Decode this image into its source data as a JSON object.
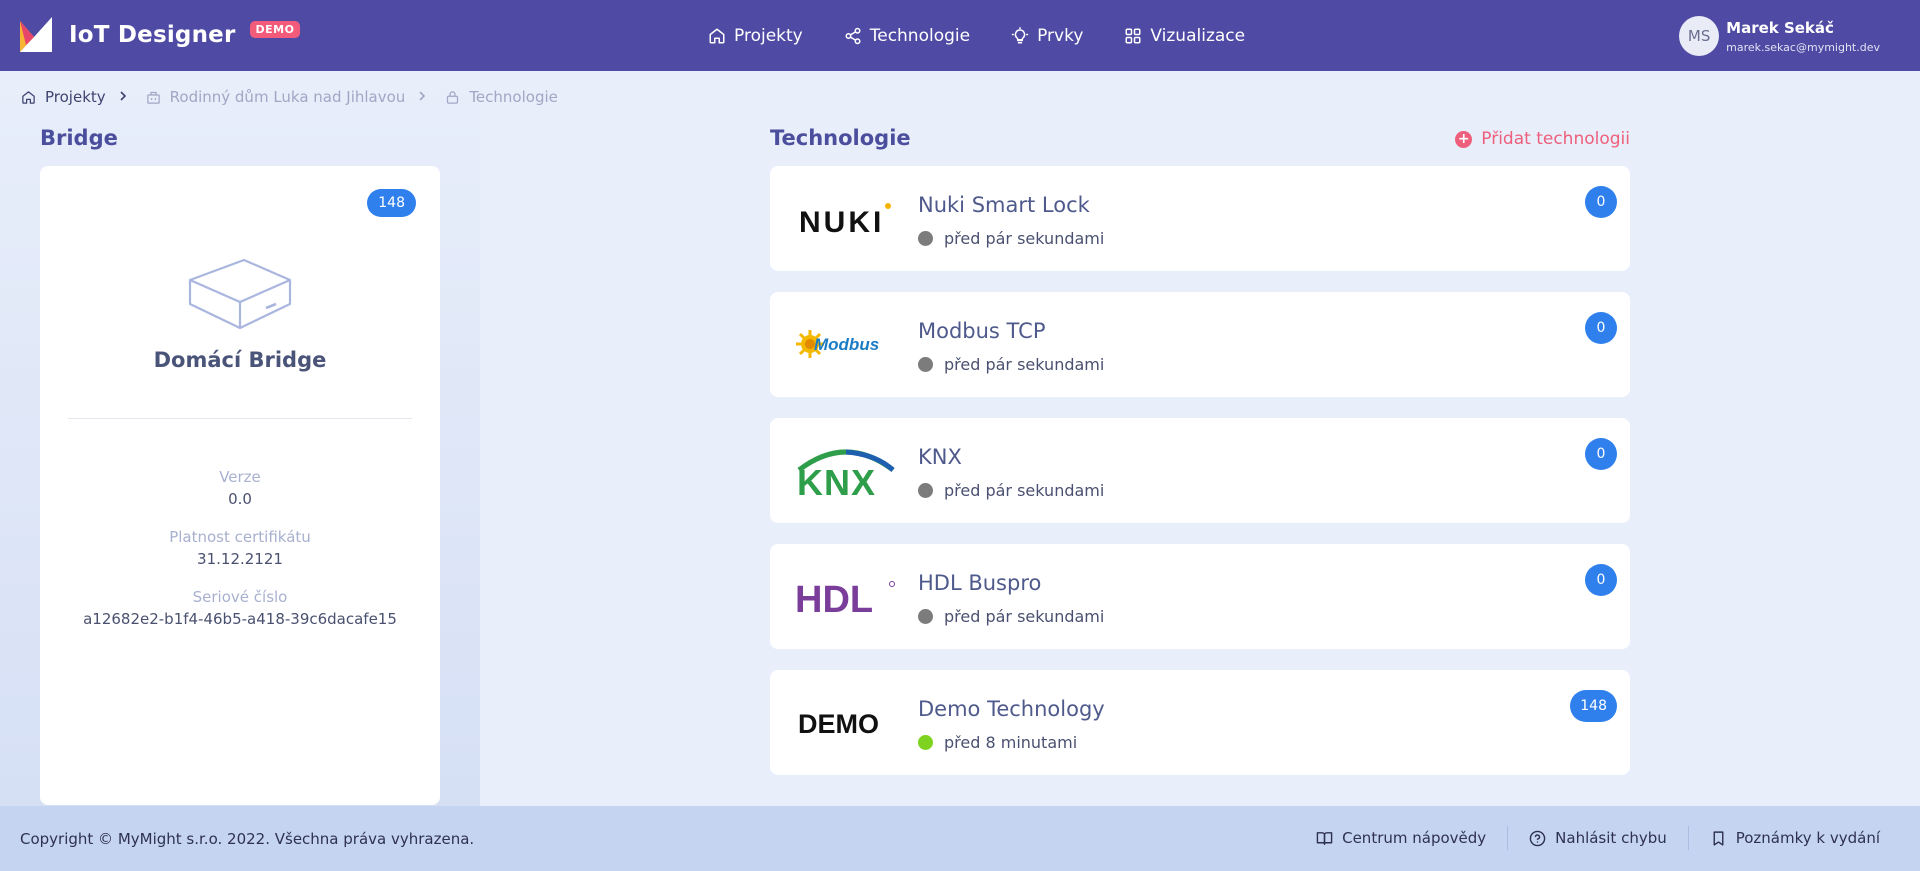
{
  "header": {
    "app_name": "IoT Designer",
    "demo_tag": "DEMO",
    "nav": [
      {
        "label": "Projekty",
        "icon": "home-icon"
      },
      {
        "label": "Technologie",
        "icon": "share-icon"
      },
      {
        "label": "Prvky",
        "icon": "bulb-icon"
      },
      {
        "label": "Vizualizace",
        "icon": "grid-icon"
      }
    ],
    "user": {
      "initials": "MS",
      "name": "Marek Sekáč",
      "email": "marek.sekac@mymight.dev"
    },
    "colors": {
      "bar": "#4f4aa3",
      "demo_tag": "#f25c7a"
    }
  },
  "breadcrumb": [
    {
      "label": "Projekty",
      "icon": "home-icon"
    },
    {
      "label": "Rodinný dům Luka nad Jihlavou",
      "icon": "building-icon"
    },
    {
      "label": "Technologie",
      "icon": "lock-icon"
    }
  ],
  "bridge": {
    "section_title": "Bridge",
    "badge": "148",
    "name": "Domácí Bridge",
    "version_label": "Verze",
    "version_value": "0.0",
    "cert_label": "Platnost certifikátu",
    "cert_value": "31.12.2121",
    "serial_label": "Seriové číslo",
    "serial_value": "a12682e2-b1f4-46b5-a418-39c6dacafe15"
  },
  "technologies": {
    "section_title": "Technologie",
    "add_label": "Přidat technologii",
    "items": [
      {
        "name": "Nuki Smart Lock",
        "logo": "NUKI",
        "status": "před pár sekundami",
        "status_color": "#7c7c7c",
        "count": "0"
      },
      {
        "name": "Modbus TCP",
        "logo": "Modbus",
        "status": "před pár sekundami",
        "status_color": "#7c7c7c",
        "count": "0"
      },
      {
        "name": "KNX",
        "logo": "KNX",
        "status": "před pár sekundami",
        "status_color": "#7c7c7c",
        "count": "0"
      },
      {
        "name": "HDL Buspro",
        "logo": "HDL",
        "status": "před pár sekundami",
        "status_color": "#7c7c7c",
        "count": "0"
      },
      {
        "name": "Demo Technology",
        "logo": "DEMO",
        "status": "před 8 minutami",
        "status_color": "#7ed321",
        "count": "148"
      }
    ]
  },
  "footer": {
    "copyright": "Copyright © MyMight s.r.o. 2022. Všechna práva vyhrazena.",
    "links": [
      {
        "label": "Centrum nápovědy",
        "icon": "book-icon"
      },
      {
        "label": "Nahlásit chybu",
        "icon": "help-circle-icon"
      },
      {
        "label": "Poznámky k vydání",
        "icon": "bookmark-icon"
      }
    ]
  }
}
